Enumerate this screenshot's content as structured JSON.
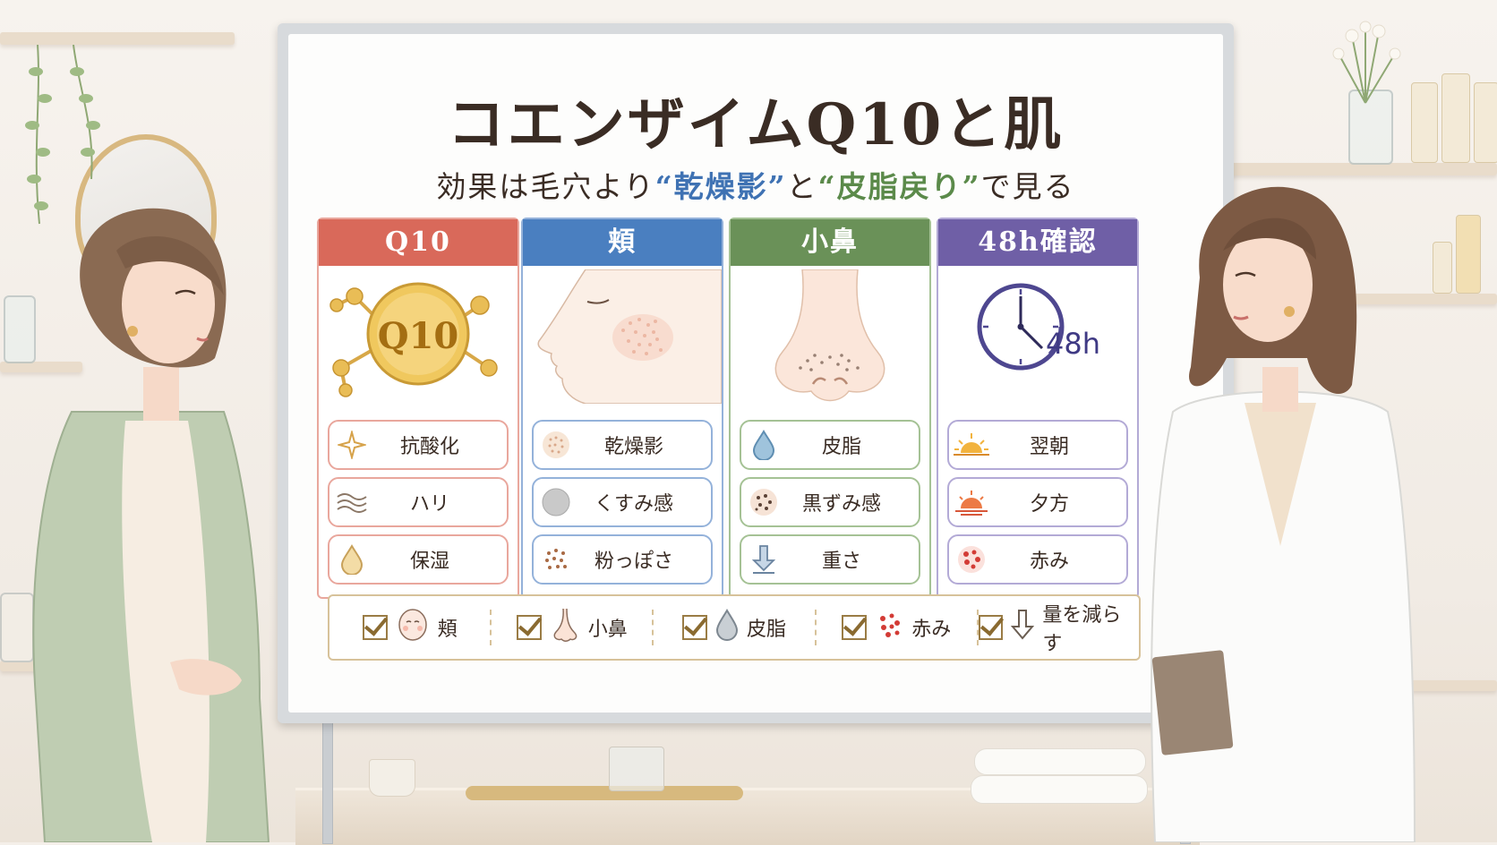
{
  "title": "コエンザイムQ10と肌",
  "subtitle": {
    "prefix": "効果は毛穴より",
    "term1": "“乾燥影”",
    "joiner": "と",
    "term2": "“皮脂戻り”",
    "suffix": "で見る"
  },
  "colors": {
    "q10": "#d9695a",
    "cheek": "#4a7fc0",
    "nose": "#6a9158",
    "check48": "#6f5fa6"
  },
  "cards": [
    {
      "id": "q10",
      "header": "Q10",
      "illustration": "q10-molecule",
      "badge": "Q10",
      "items": [
        {
          "label": "抗酸化",
          "icon": "sparkle-icon"
        },
        {
          "label": "ハリ",
          "icon": "wave-icon"
        },
        {
          "label": "保湿",
          "icon": "droplet-icon"
        }
      ]
    },
    {
      "id": "cheek",
      "header": "頬",
      "illustration": "face-profile",
      "items": [
        {
          "label": "乾燥影",
          "icon": "dry-dots-icon"
        },
        {
          "label": "くすみ感",
          "icon": "dull-circle-icon"
        },
        {
          "label": "粉っぽさ",
          "icon": "powder-dots-icon"
        }
      ]
    },
    {
      "id": "nose",
      "header": "小鼻",
      "illustration": "nose",
      "items": [
        {
          "label": "皮脂",
          "icon": "oil-drop-icon"
        },
        {
          "label": "黒ずみ感",
          "icon": "blackhead-dots-icon"
        },
        {
          "label": "重さ",
          "icon": "down-arrow-icon"
        }
      ]
    },
    {
      "id": "check48",
      "header": "48h確認",
      "illustration": "clock",
      "clock_label": "48h",
      "items": [
        {
          "label": "翌朝",
          "icon": "sunrise-icon"
        },
        {
          "label": "夕方",
          "icon": "sunset-icon"
        },
        {
          "label": "赤み",
          "icon": "redness-dots-icon"
        }
      ]
    }
  ],
  "checklist": [
    {
      "label": "頬",
      "icon": "face-icon"
    },
    {
      "label": "小鼻",
      "icon": "nose-icon"
    },
    {
      "label": "皮脂",
      "icon": "oil-drop-icon"
    },
    {
      "label": "赤み",
      "icon": "redness-dots-icon"
    },
    {
      "label": "量を減らす",
      "icon": "down-arrow-icon"
    }
  ]
}
